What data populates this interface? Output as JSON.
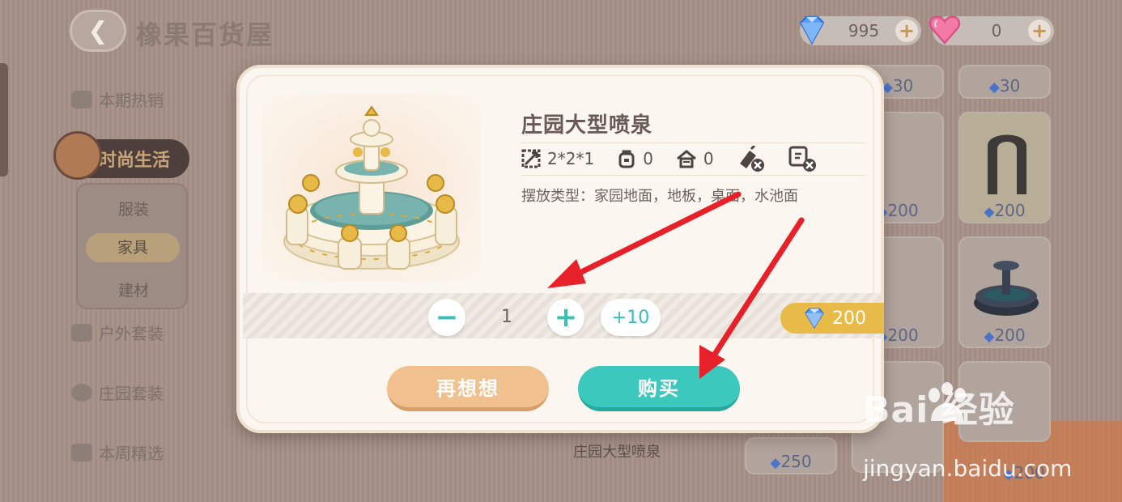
{
  "shop": {
    "title": "橡果百货屋",
    "back_icon": "back-arrow-icon"
  },
  "currencies": [
    {
      "name": "diamond",
      "amount": "995",
      "icon": "blue-gem-icon",
      "color": "#4a8ef0"
    },
    {
      "name": "heart",
      "amount": "0",
      "icon": "pink-heart-gem-icon",
      "color": "#f06d9b"
    }
  ],
  "sidebar": {
    "items": [
      {
        "label": "本期热销",
        "icon": "hot-sale-icon"
      },
      {
        "label": "时尚生活",
        "icon": "fashion-life-icon",
        "active": true
      },
      {
        "label": "户外套装",
        "icon": "outdoor-set-icon"
      },
      {
        "label": "庄园套装",
        "icon": "manor-set-icon"
      },
      {
        "label": "本周精选",
        "icon": "thumbs-up-icon"
      }
    ],
    "sub_items": [
      {
        "label": "服装"
      },
      {
        "label": "家具",
        "active": true
      },
      {
        "label": "建材"
      }
    ]
  },
  "background_grid": {
    "prices": [
      "30",
      "30",
      "200",
      "200",
      "200",
      "200",
      "250",
      "200"
    ],
    "caption": "庄园大型喷泉"
  },
  "dialog": {
    "item_name": "庄园大型喷泉",
    "stats": {
      "size": "2*2*1",
      "bag_count": "0",
      "house_count": "0"
    },
    "stat_icons": [
      "size-icon",
      "backpack-icon",
      "house-icon",
      "no-clean-icon",
      "no-edit-icon"
    ],
    "placement": "摆放类型：家园地面，地板，桌面，水池面",
    "quantity": "1",
    "plus10_label": "+10",
    "price": "200",
    "cancel_label": "再想想",
    "buy_label": "购买"
  },
  "watermark": {
    "logo": "Bai  经验",
    "url": "jingyan.baidu.com"
  },
  "colors": {
    "accent_teal": "#3cc8bd",
    "cancel_orange": "#f0c08f",
    "price_gold": "#e8bb48",
    "arrow_red": "#e8202a"
  }
}
